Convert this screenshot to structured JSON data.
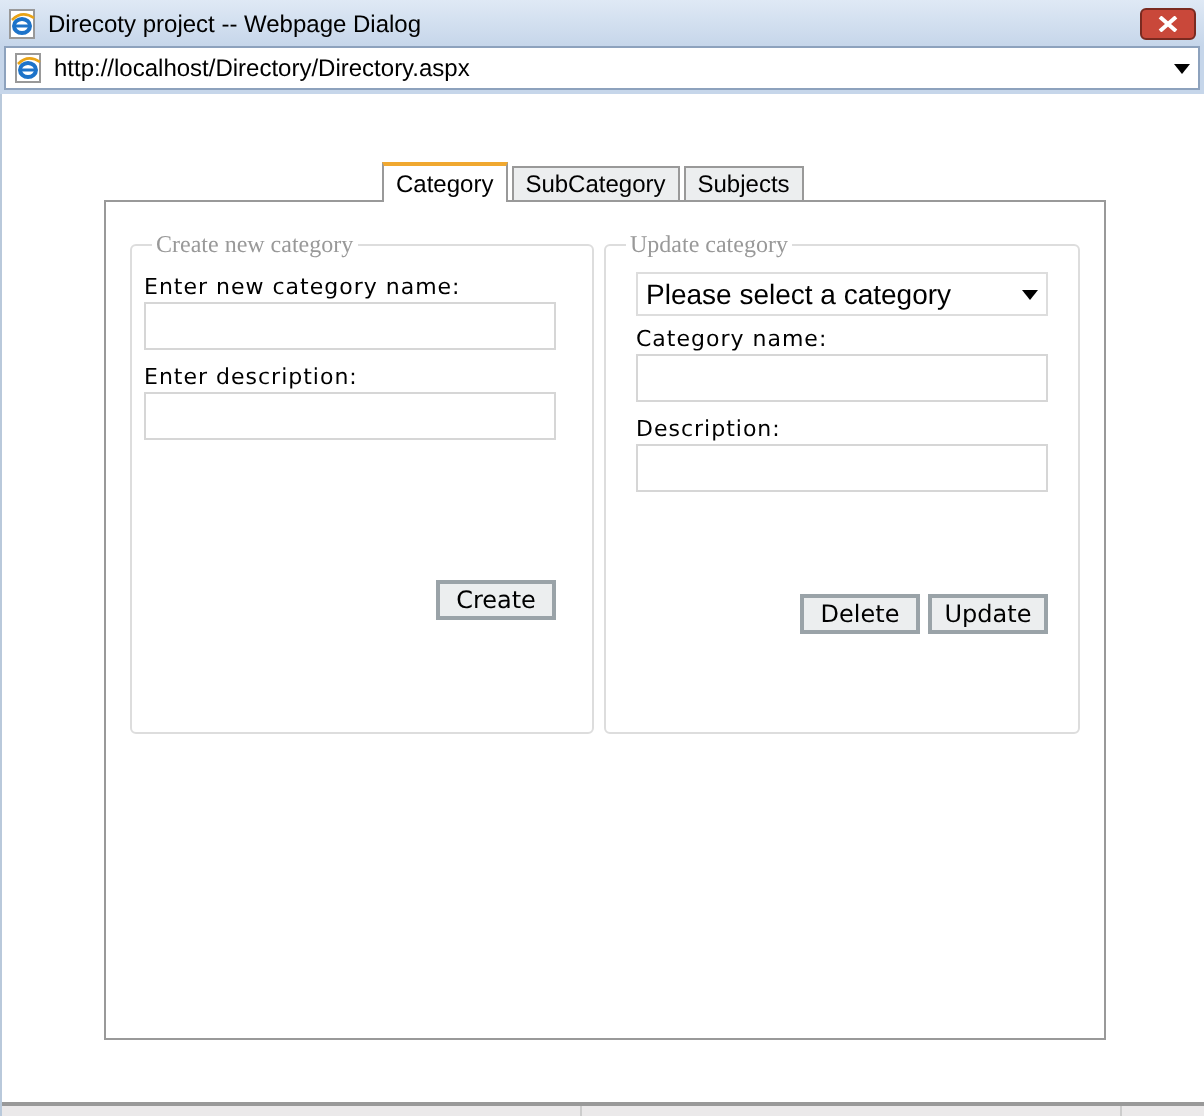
{
  "window": {
    "title": "Direcoty project -- Webpage Dialog"
  },
  "address": {
    "url": "http://localhost/Directory/Directory.aspx"
  },
  "tabs": [
    {
      "label": "Category",
      "selected": true
    },
    {
      "label": "SubCategory",
      "selected": false
    },
    {
      "label": "Subjects",
      "selected": false
    }
  ],
  "create": {
    "legend": "Create new category",
    "name_label": "Enter new category name:",
    "description_label": "Enter description:",
    "button": "Create"
  },
  "update": {
    "legend": "Update category",
    "select": "Please select a category",
    "name_label": "Category name:",
    "description_label": "Description:",
    "buttons": [
      "Delete",
      "Update"
    ]
  }
}
